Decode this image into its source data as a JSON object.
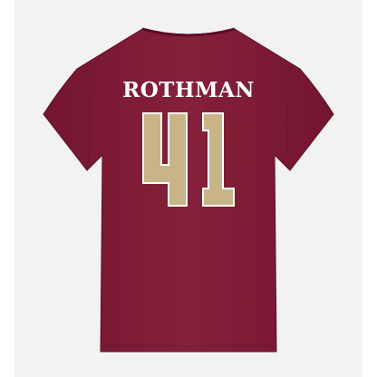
{
  "product": {
    "player_name": "ROTHMAN",
    "jersey_number": "41"
  },
  "colors": {
    "background": "#f2f2f2",
    "shirt": "#7f1934",
    "number_fill": "#c8b487",
    "number_outline": "#ffffff"
  },
  "icons": {
    "garment": "v-neck-tshirt-back"
  }
}
